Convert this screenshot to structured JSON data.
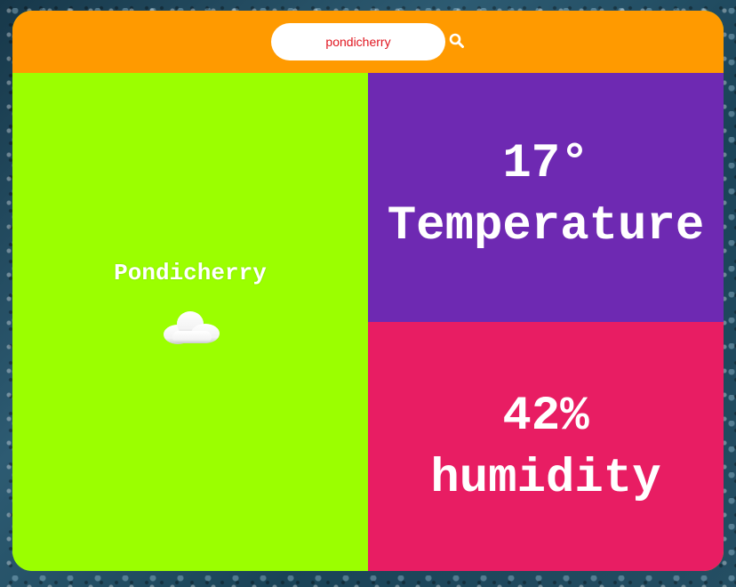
{
  "search": {
    "value": "pondicherry",
    "icon": "search-icon"
  },
  "weather": {
    "city": "Pondicherry",
    "condition_icon": "cloud-icon",
    "temperature_value": "17°",
    "temperature_label": "Temperature",
    "humidity_value": "42%",
    "humidity_label": "humidity"
  },
  "colors": {
    "topbar": "#ff9a00",
    "left_panel": "#9bff00",
    "temperature_panel": "#6e29b2",
    "humidity_panel": "#e81d63",
    "search_text": "#e0151f",
    "text": "#ffffff"
  }
}
